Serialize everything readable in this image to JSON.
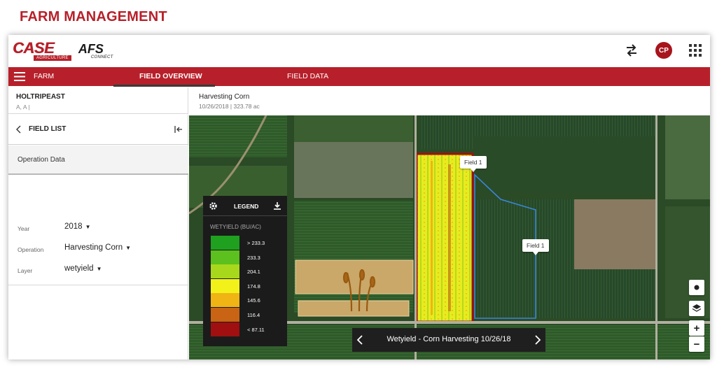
{
  "page": {
    "heading": "FARM MANAGEMENT"
  },
  "header": {
    "brand_case": "CASE",
    "brand_case_sub": "AGRICULTURE",
    "brand_afs": "AFS",
    "brand_afs_sub": "CONNECT",
    "avatar_initials": "CP",
    "icons": {
      "swap": "swap-arrows-icon",
      "apps": "apps-grid-icon"
    }
  },
  "nav": {
    "items": [
      {
        "label": "FARM",
        "active": false
      },
      {
        "label": "FIELD OVERVIEW",
        "active": true
      },
      {
        "label": "FIELD DATA",
        "active": false
      }
    ]
  },
  "farm": {
    "name": "HOLTRIPEAST",
    "sub": "A, A |"
  },
  "operation_header": {
    "title": "Harvesting Corn",
    "sub": "10/26/2018 | 323.78 ac"
  },
  "sidebar": {
    "field_list_label": "FIELD LIST",
    "operation_data_label": "Operation Data",
    "properties": [
      {
        "label": "Year",
        "value": "2018"
      },
      {
        "label": "Operation",
        "value": "Harvesting Corn"
      },
      {
        "label": "Layer",
        "value": "wetyield"
      }
    ]
  },
  "legend": {
    "title": "LEGEND",
    "subtitle": "WETYIELD (BU/AC)",
    "entries": [
      {
        "value": "> 233.3",
        "color": "#1fa01f"
      },
      {
        "value": "233.3",
        "color": "#5cc01e"
      },
      {
        "value": "204.1",
        "color": "#a8d81c"
      },
      {
        "value": "174.8",
        "color": "#f2f21a"
      },
      {
        "value": "145.6",
        "color": "#f0b414"
      },
      {
        "value": "116.4",
        "color": "#c86414"
      },
      {
        "value": "< 87.11",
        "color": "#a01010"
      }
    ]
  },
  "map": {
    "field_tags": [
      "Field 1",
      "Field 1"
    ],
    "caption": "Wetyield - Corn Harvesting 10/26/18",
    "controls": {
      "zoom_in": "+",
      "zoom_out": "−"
    }
  },
  "colors": {
    "brand_red": "#b7202a",
    "avatar_red": "#a8141c"
  }
}
